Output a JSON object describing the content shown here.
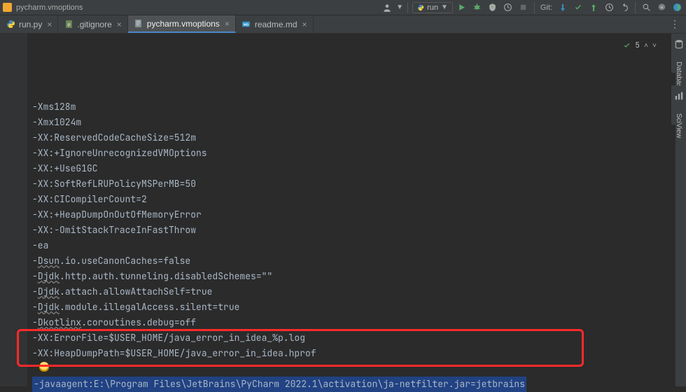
{
  "toolbar": {
    "breadcrumb": "pycharm.vmoptions",
    "run_config": {
      "label": "run"
    },
    "git_label": "Git:"
  },
  "tabs": [
    {
      "label": "run.py",
      "icon": "python",
      "active": false
    },
    {
      "label": ".gitignore",
      "icon": "gitignore",
      "active": false
    },
    {
      "label": "pycharm.vmoptions",
      "icon": "text",
      "active": true
    },
    {
      "label": "readme.md",
      "icon": "markdown",
      "active": false
    }
  ],
  "status": {
    "checks": "5"
  },
  "code_lines": [
    {
      "text": "-Xms128m",
      "plain": true
    },
    {
      "text": "-Xmx1024m",
      "plain": true
    },
    {
      "text": "-XX:ReservedCodeCacheSize=512m",
      "plain": true
    },
    {
      "text": "-XX:+IgnoreUnrecognizedVMOptions",
      "plain": true
    },
    {
      "text": "-XX:+UseG1GC",
      "plain": true
    },
    {
      "text": "-XX:SoftRefLRUPolicyMSPerMB=50",
      "plain": true
    },
    {
      "text": "-XX:CICompilerCount=2",
      "plain": true
    },
    {
      "text": "-XX:+HeapDumpOnOutOfMemoryError",
      "plain": true
    },
    {
      "text": "-XX:-OmitStackTraceInFastThrow",
      "plain": true
    },
    {
      "text": "-ea",
      "plain": true
    },
    {
      "wavy": "Dsun",
      "rest": ".io.useCanonCaches=false",
      "prefix": "-"
    },
    {
      "wavy": "Djdk",
      "rest": ".http.auth.tunneling.disabledSchemes=\"\"",
      "prefix": "-"
    },
    {
      "wavy": "Djdk",
      "rest": ".attach.allowAttachSelf=true",
      "prefix": "-"
    },
    {
      "wavy": "Djdk",
      "rest": ".module.illegalAccess.silent=true",
      "prefix": "-"
    },
    {
      "wavy": "Dkotlinx",
      "rest": ".coroutines.debug=off",
      "prefix": "-"
    },
    {
      "text": "-XX:ErrorFile=$USER_HOME/java_error_in_idea_%p.log",
      "plain": true
    },
    {
      "text": "-XX:HeapDumpPath=$USER_HOME/java_error_in_idea.hprof",
      "plain": true
    },
    {
      "bulb": true
    },
    {
      "selected": "-javaagent:E:\\Program Files\\JetBrains\\PyCharm 2022.1\\activation\\ja-netfilter.jar=jetbrains"
    }
  ],
  "side_tools": {
    "database": "Database",
    "sciview": "SciView"
  }
}
